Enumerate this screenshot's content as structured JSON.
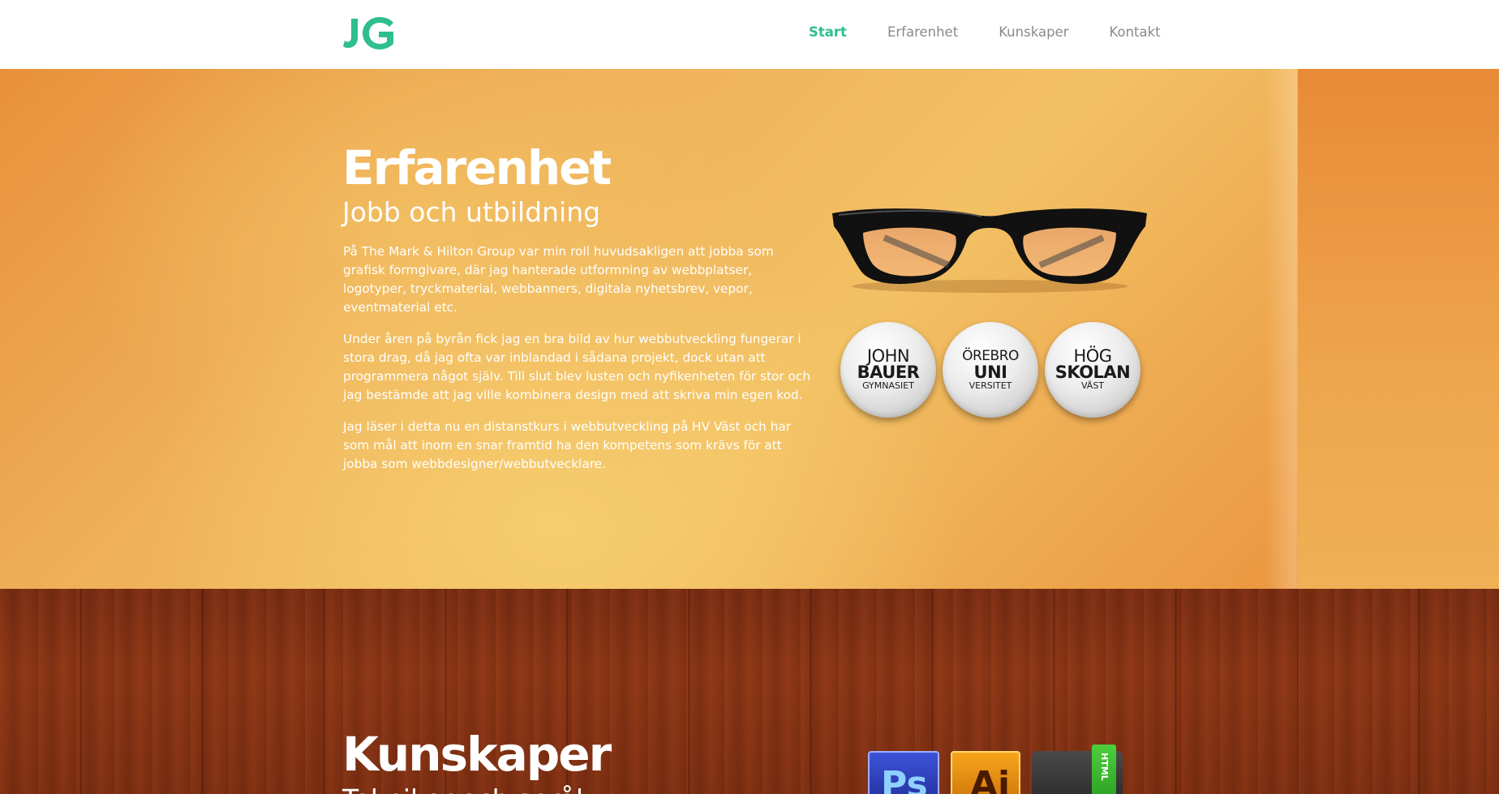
{
  "header": {
    "logo_text": "JG",
    "nav": [
      {
        "label": "Start",
        "active": true
      },
      {
        "label": "Erfarenhet",
        "active": false
      },
      {
        "label": "Kunskaper",
        "active": false
      },
      {
        "label": "Kontakt",
        "active": false
      }
    ],
    "accent_color": "#2fbf8c"
  },
  "experience": {
    "title": "Erfarenhet",
    "subtitle": "Jobb och utbildning",
    "paragraphs": [
      "På The Mark & Hilton Group var min roll huvudsakligen att jobba som grafisk formgivare, där jag hanterade utformning av webbplatser, logotyper, tryckmaterial, webbanners, digitala nyhetsbrev, vepor, eventmaterial etc.",
      "Under åren på byrån fick jag en bra bild av hur webbutveckling fungerar i stora drag, då jag ofta var inblandad i sådana projekt, dock utan att programmera något själv. Till slut blev lusten och nyfikenheten för stor och jag bestämde att jag ville kombinera design med att skriva min egen kod.",
      "Jag läser i detta nu en distanstkurs i webbutveckling på HV Väst och har som mål att inom en snar framtid ha den kompetens som krävs för att jobba som webbdesigner/webbutvecklare."
    ],
    "illustration_icon": "glasses-icon",
    "badges": [
      {
        "line1": "JOHN",
        "line2": "BAUER",
        "line3": "GYMNASIET"
      },
      {
        "line1": "ÖREBRO",
        "line2": "UNI",
        "line3": "VERSITET"
      },
      {
        "line1": "HÖG",
        "line2": "SKOLAN",
        "line3": "VÄST"
      }
    ]
  },
  "skills": {
    "title": "Kunskaper",
    "subtitle": "Tekniker och språk",
    "icons": [
      {
        "name": "photoshop-icon",
        "label": "Ps"
      },
      {
        "name": "illustrator-icon",
        "label": "Ai"
      },
      {
        "name": "html-folder-icon",
        "label": "HTML"
      }
    ]
  }
}
